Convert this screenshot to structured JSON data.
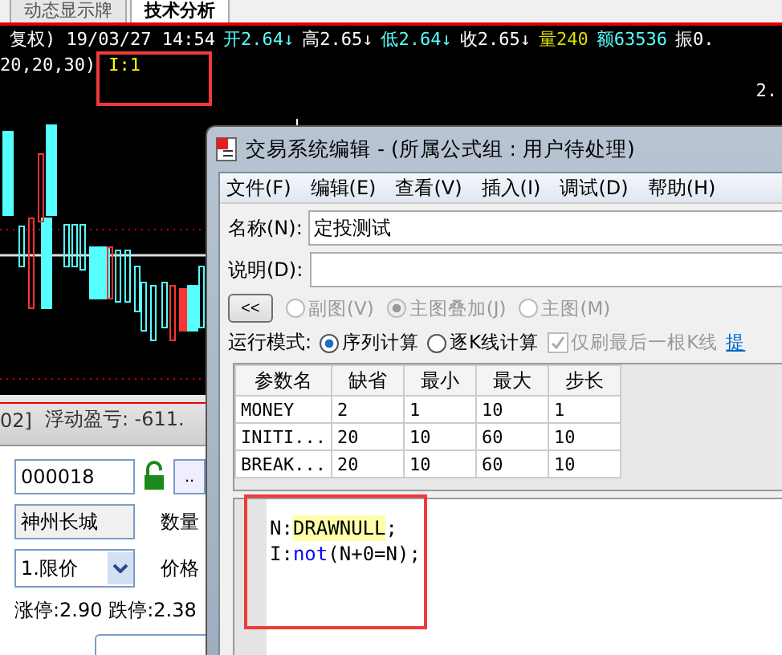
{
  "tabs": [
    {
      "label": "动态显示牌",
      "selected": false
    },
    {
      "label": "技术分析",
      "selected": true
    }
  ],
  "quote_line": [
    {
      "text": "复权) 19/03/27 14:54",
      "color": "#ffffff"
    },
    {
      "text": "开2.64↓",
      "color": "#55ffff"
    },
    {
      "text": "高2.65↓",
      "color": "#ffffff"
    },
    {
      "text": "低2.64↓",
      "color": "#55ffff"
    },
    {
      "text": "收2.65↓",
      "color": "#ffffff"
    },
    {
      "text": "量240",
      "color": "#dddd00"
    },
    {
      "text": "额63536",
      "color": "#55ffff"
    },
    {
      "text": "振0.",
      "color": "#ffffff"
    }
  ],
  "indicator_line": {
    "params": "20,20,30)",
    "value": "I:1"
  },
  "price_tick": "2.",
  "position_bar": {
    "account": "02]",
    "pnl": "浮动盈亏: -611."
  },
  "order_panel": {
    "code": "000018",
    "browse": "..",
    "stock_name": "神州长城",
    "quantity_label": "数量",
    "order_type": "1.限价",
    "price_label": "价格",
    "limits": "涨停:2.90 跌停:2.38"
  },
  "dialog": {
    "title": "交易系统编辑 - (所属公式组 : 用户待处理)",
    "menu": [
      "文件(F)",
      "编辑(E)",
      "查看(V)",
      "插入(I)",
      "调试(D)",
      "帮助(H)"
    ],
    "name_label": "名称(N):",
    "name_value": "定投测试",
    "desc_label": "说明(D):",
    "collapse_button": "<<",
    "chart_modes": [
      {
        "label": "副图(V)",
        "selected": false,
        "disabled": true
      },
      {
        "label": "主图叠加(J)",
        "selected": true,
        "disabled": true
      },
      {
        "label": "主图(M)",
        "selected": false,
        "disabled": true
      }
    ],
    "run_mode_label": "运行模式:",
    "run_modes": [
      {
        "label": "序列计算",
        "selected": true
      },
      {
        "label": "逐K线计算",
        "selected": false
      }
    ],
    "refresh_option": {
      "label": "仅刷最后一根K线",
      "checked": true,
      "disabled": true
    },
    "hint_link": "提",
    "params_table": {
      "columns": [
        "参数名",
        "缺省",
        "最小",
        "最大",
        "步长"
      ],
      "rows": [
        [
          "MONEY",
          "2",
          "1",
          "10",
          "1"
        ],
        [
          "INITI...",
          "20",
          "10",
          "60",
          "10"
        ],
        [
          "BREAK...",
          "20",
          "10",
          "60",
          "10"
        ]
      ]
    },
    "code_lines": [
      [
        {
          "text": "N:",
          "kind": "plain"
        },
        {
          "text": "DRAWNULL",
          "kind": "function"
        },
        {
          "text": ";",
          "kind": "plain"
        }
      ],
      [
        {
          "text": "I:",
          "kind": "plain"
        },
        {
          "text": "not",
          "kind": "keyword"
        },
        {
          "text": "(N+0=N);",
          "kind": "plain"
        }
      ]
    ]
  }
}
